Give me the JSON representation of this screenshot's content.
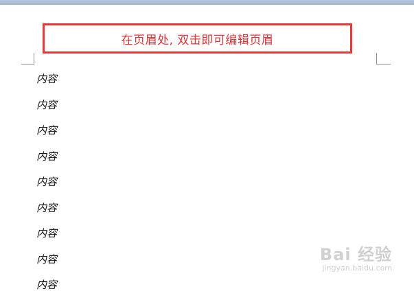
{
  "header": {
    "annotation": "在页眉处, 双击即可编辑页眉"
  },
  "body": {
    "lines": [
      "内容",
      "内容",
      "内容",
      "内容",
      "内容",
      "内容",
      "内容",
      "内容",
      "内容"
    ]
  },
  "watermark": {
    "logo": "Bai 经验",
    "url": "jingyan.baidu.com"
  },
  "colors": {
    "annotation": "#d9363a",
    "text": "#111111"
  }
}
